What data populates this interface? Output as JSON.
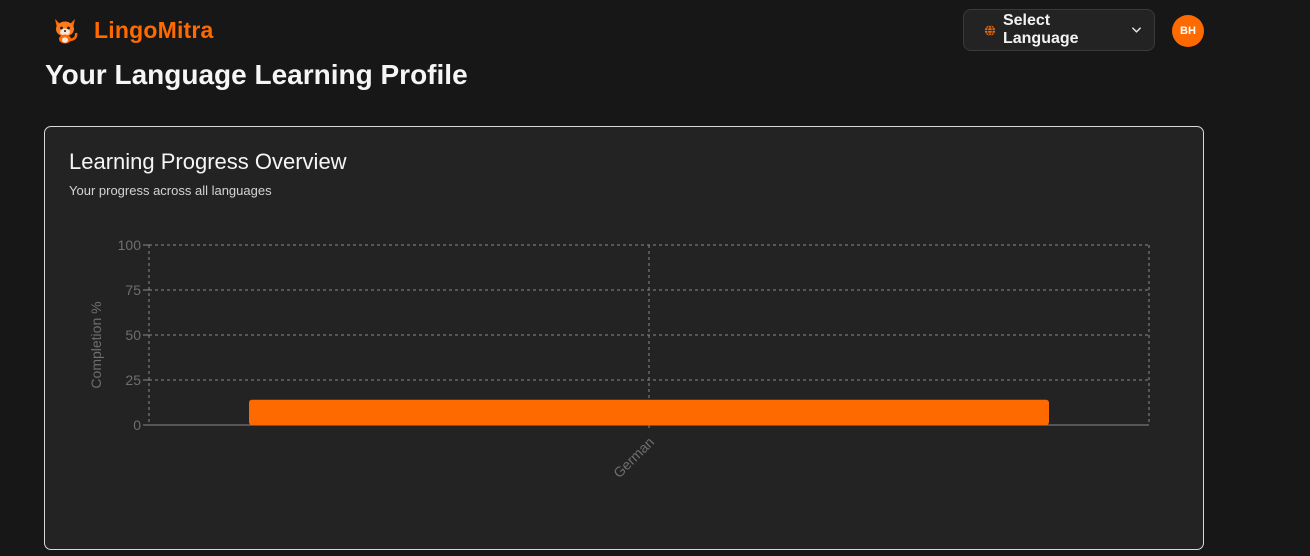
{
  "header": {
    "brand_name": "LingoMitra",
    "brand_logo_icon": "fox-mascot-icon",
    "language_select_label": "Select Language",
    "language_select_icon": "globe-icon",
    "language_select_chevron": "chevron-down-icon",
    "avatar_initials": "BH"
  },
  "page": {
    "title": "Your Language Learning Profile"
  },
  "progress_card": {
    "title": "Learning Progress Overview",
    "subtitle": "Your progress across all languages"
  },
  "colors": {
    "accent": "#ff6a00",
    "background": "#171717",
    "card_background": "#232323"
  },
  "chart_data": {
    "type": "bar",
    "categories": [
      "German"
    ],
    "values": [
      14
    ],
    "ylabel": "Completion %",
    "xlabel": "",
    "ylim": [
      0,
      100
    ],
    "yticks": [
      0,
      25,
      50,
      75,
      100
    ],
    "grid": true,
    "bar_color": "#ff6a00"
  }
}
